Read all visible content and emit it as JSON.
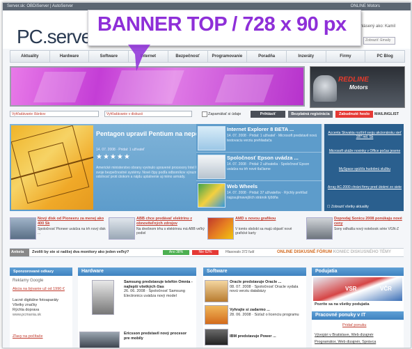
{
  "topbar": {
    "left": "Server.sk: OBDiServer | AutoServer",
    "right": "ONLINE Motors"
  },
  "header": {
    "logo_text": "PC.server",
    "user_label": "Prihlásený ako: Kamil",
    "select_value": "Zobraziť: Emaily"
  },
  "callout": {
    "text": "BANNER TOP / 728 x 90 px",
    "color": "#8e2fd8"
  },
  "nav": [
    "Aktuality",
    "Hardware",
    "Software",
    "Internet",
    "Bezpečnosť",
    "Programovanie",
    "Poradňa",
    "Inzeráty",
    "Firmy",
    "PC Blog"
  ],
  "ads": {
    "redline_top": "REDLINE",
    "redline_bottom": "Motors"
  },
  "forms": {
    "search1_placeholder": "Vyhľadávanie článkov",
    "search2_placeholder": "Vyhľadávanie v diskusii",
    "remember_label": "Zapamätať si údaje",
    "login_button": "Prihlásiť",
    "register_button": "Bezplatná registrácia",
    "forgot_button": "Zabudnuté heslo",
    "mailinglist": "MAILINGLIST"
  },
  "featured": {
    "title": "Pentagon upravil Pentium na nepoznanie",
    "meta": "14. 07. 2008 · Pridal: 1 užívateľ",
    "stars": "★★★★★",
    "desc": "Americké ministerstvo obrany vyvinulo upravené procesory Intel Pentium pre svoje bezpečnostné systémy. Nové čipy podľa odborníkov výrazne zvyšujú odolnosť proti útokom a nájdu uplatnenie aj mimo armády.",
    "list": [
      {
        "title": "Internet Explorer 8 BETA ...",
        "meta": "14. 07. 2008 · Pridal: 1 užívateľ · Microsoft predstavil novú testovaciu verziu prehliadača"
      },
      {
        "title": "Spoločnosť Epson uvádza ...",
        "meta": "14. 07. 2008 · Pridal: 2 užívatelia · Spoločnosť Epson uvádza na trh nové tlačiarne"
      },
      {
        "title": "Web Wheels",
        "meta": "14. 07. 2008 · Pridal: 37 užívateľov · Rýchly prehľad najzaujímavejších stránok týždňa"
      }
    ],
    "right": [
      "Accenta Slovakia rozšíril svoju akcionársku sieť 187 mil. Sk",
      "Microsoft ukáže novinky v Office počas jesene",
      "MySpace spúšťa hudobnú službu",
      "Array AC-2000 chráni firmy pred útokmi zo siete"
    ],
    "right_check": "Zobraziť všetky aktuality"
  },
  "newsrow": [
    {
      "title": "Nový disk od Pioneeru za menej ako 400 Sk",
      "desc": "Spoločnosť Pioneer uvádza na trh nový disk ..."
    },
    {
      "title": "ABB chce predávať elektrinu z obnoviteľných zdrojov",
      "desc": "Na dnešnom trhu s elektrinou má ABB veľký podiel"
    },
    {
      "title": "AMD s novou grafikou",
      "desc": "V tomto období sa majú objaviť nové grafické karty"
    },
    {
      "title": "Dopredaj Sonicu 2008 ponúkaju nové ceny",
      "desc": "Sony odhalila nový notebook série VGN-Z"
    }
  ],
  "poll": {
    "label": "Anketa",
    "question": "Zvolili by ste si radšej dva monitory ako jeden veľký?",
    "yes": "Áno 38%",
    "no": "Nie 62%",
    "votes": "Hlasovalo 372 ľudí",
    "forum_label": "ONLINE DISKUSNÉ FÓRUM",
    "forum_rest": "KONIEC DISKUSNÉHO TÉMY"
  },
  "bottom": {
    "left_head": "Sponzorované odkazy",
    "left_brand": "Reklamy Google",
    "left_items": [
      "Akcia na bývanie už od 1990 €",
      "Lacné digitálne fotoaparáty",
      "Všetky značky",
      "Rýchla doprava",
      "www.pcmania.sk"
    ],
    "left_item2": "Zľavy na počítače",
    "hw_head": "Hardware",
    "hw_items": [
      {
        "title": "Samsung predstavuje telefón Omnia - najlepší všetkých čias",
        "meta": "26. 06. 2008 · Spoločnosť Samsung Electronics uvádza nový model"
      },
      {
        "title": "Ericsson predstavil nový procesor pre mobily",
        "meta": ""
      }
    ],
    "sw_head": "Software",
    "sw_items": [
      {
        "title": "Oracle predstavuje Oracle ...",
        "meta": "08. 07. 2008 · Spoločnosť Oracle vydala novú verziu databázy"
      },
      {
        "title": "Vyhrajte si zadarmo ...",
        "meta": "28. 06. 2008 · Súťaž o licenciu programu"
      },
      {
        "title": "IBM predstavuje Power ...",
        "meta": ""
      }
    ],
    "rt_head": "Podujatia",
    "rt_sub": "Pozrite sa na všetky podujatia",
    "rt_head2": "Pracovné ponuky v IT",
    "rt_items": [
      "Pridať ponuku",
      "Vývojári v Bratislave, Web dizajnér",
      "Programátor, Web dizajnér, Správca"
    ],
    "rt_vsr": "VSR",
    "rt_vcr": "VČR"
  }
}
